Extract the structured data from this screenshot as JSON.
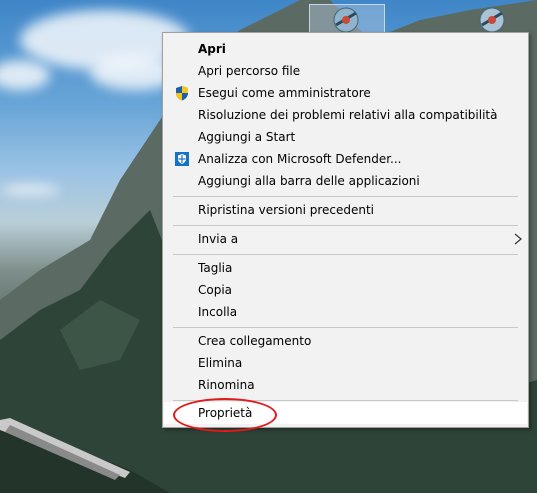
{
  "menu": {
    "items": [
      {
        "label": "Apri",
        "icon": "",
        "bold": true
      },
      {
        "label": "Apri percorso file",
        "icon": ""
      },
      {
        "label": "Esegui come amministratore",
        "icon": "uac-shield-icon"
      },
      {
        "label": "Risoluzione dei problemi relativi alla compatibilità",
        "icon": ""
      },
      {
        "label": "Aggiungi a Start",
        "icon": ""
      },
      {
        "label": "Analizza con Microsoft Defender...",
        "icon": "defender-icon"
      },
      {
        "label": "Aggiungi alla barra delle applicazioni",
        "icon": ""
      },
      {
        "label": "Ripristina versioni precedenti",
        "icon": ""
      },
      {
        "label": "Invia a",
        "icon": "",
        "submenu": true
      },
      {
        "label": "Taglia",
        "icon": ""
      },
      {
        "label": "Copia",
        "icon": ""
      },
      {
        "label": "Incolla",
        "icon": ""
      },
      {
        "label": "Crea collegamento",
        "icon": ""
      },
      {
        "label": "Elimina",
        "icon": ""
      },
      {
        "label": "Rinomina",
        "icon": ""
      },
      {
        "label": "Proprietà",
        "icon": "",
        "highlighted": true
      }
    ]
  },
  "colors": {
    "menu_bg": "#f2f2f2",
    "annotation": "#e31a1a",
    "shield_blue": "#1f5ea8",
    "shield_yellow": "#f5c518",
    "defender_blue": "#1573c7"
  }
}
